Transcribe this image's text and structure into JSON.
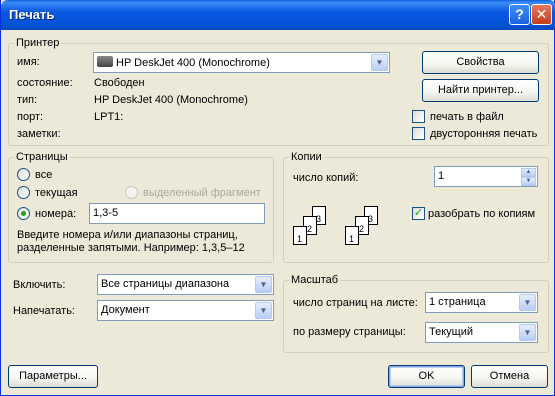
{
  "window": {
    "title": "Печать",
    "help_glyph": "?",
    "close_glyph": "✕"
  },
  "printer": {
    "group_title": "Принтер",
    "name_label": "имя:",
    "name_value": "HP DeskJet 400 (Monochrome)",
    "status_label": "состояние:",
    "status_value": "Свободен",
    "type_label": "тип:",
    "type_value": "HP DeskJet 400 (Monochrome)",
    "port_label": "порт:",
    "port_value": "LPT1:",
    "notes_label": "заметки:",
    "properties_button": "Свойства",
    "find_printer_button": "Найти принтер...",
    "print_to_file_label": "печать в файл",
    "print_to_file_checked": false,
    "duplex_label": "двусторонняя печать",
    "duplex_checked": false
  },
  "pages": {
    "group_title": "Страницы",
    "all_label": "все",
    "current_label": "текущая",
    "selection_label": "выделенный фрагмент",
    "numbers_label": "номера:",
    "numbers_value": "1,3-5",
    "hint": "Введите номера и/или диапазоны страниц, разделенные запятыми. Например: 1,3,5–12",
    "selected": "numbers"
  },
  "copies": {
    "group_title": "Копии",
    "count_label": "число копий:",
    "count_value": "1",
    "collate_label": "разобрать по копиям",
    "collate_checked": true,
    "collate_page_labels": [
      "3",
      "2",
      "1"
    ]
  },
  "include": {
    "label": "Включить:",
    "value": "Все страницы диапазона"
  },
  "print_what": {
    "label": "Напечатать:",
    "value": "Документ"
  },
  "scale": {
    "group_title": "Масштаб",
    "pages_per_sheet_label": "число страниц на листе:",
    "pages_per_sheet_value": "1 страница",
    "scale_to_paper_label": "по размеру страницы:",
    "scale_to_paper_value": "Текущий"
  },
  "footer": {
    "options_button": "Параметры...",
    "ok_button": "OK",
    "cancel_button": "Отмена"
  }
}
